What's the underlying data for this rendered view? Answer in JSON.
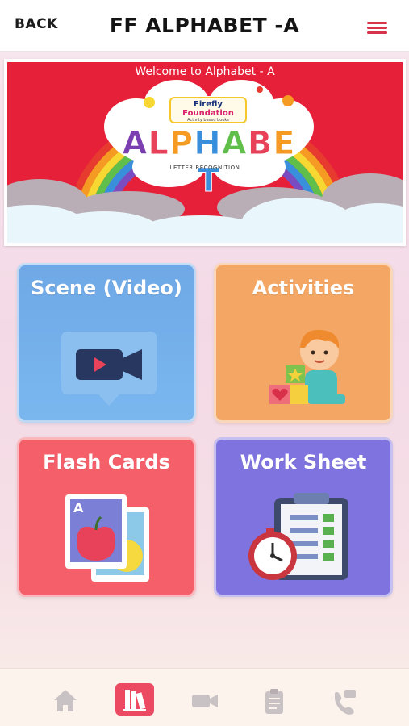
{
  "header": {
    "back_label": "BACK",
    "title": "FF ALPHABET -A",
    "menu_icon": "hamburger-menu-icon",
    "accent_color": "#d7334b"
  },
  "banner": {
    "welcome_text": "Welcome to Alphabet - A",
    "logo_line1": "Firefly",
    "logo_line2": "Foundation",
    "logo_line3": "Activity based books",
    "big_word": "ALPHABET",
    "subtitle": "LETTER RECOGNITION",
    "background_color": "#e7203a"
  },
  "tiles": [
    {
      "label": "Scene (Video)",
      "icon": "video-camera-icon",
      "color": "#6fa8e6"
    },
    {
      "label": "Activities",
      "icon": "child-with-blocks-icon",
      "color": "#f4a764"
    },
    {
      "label": "Flash Cards",
      "icon": "flash-card-icon",
      "color": "#f45f6a"
    },
    {
      "label": "Work Sheet",
      "icon": "clipboard-stopwatch-icon",
      "color": "#7f73df"
    }
  ],
  "bottom_nav": {
    "items": [
      {
        "icon": "home-icon",
        "active": false
      },
      {
        "icon": "books-icon",
        "active": true
      },
      {
        "icon": "video-icon",
        "active": false
      },
      {
        "icon": "clipboard-icon",
        "active": false
      },
      {
        "icon": "phone-contact-icon",
        "active": false
      }
    ],
    "active_color": "#ec4a63",
    "inactive_color": "#c9c2c4"
  }
}
